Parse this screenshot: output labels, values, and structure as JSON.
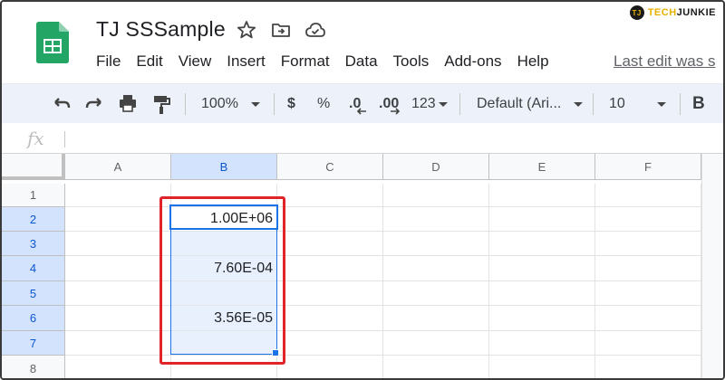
{
  "app": {
    "doc_title": "TJ SSSample",
    "menu": [
      "File",
      "Edit",
      "View",
      "Insert",
      "Format",
      "Data",
      "Tools",
      "Add-ons",
      "Help"
    ],
    "last_edit": "Last edit was s"
  },
  "watermark": {
    "badge": "TJ",
    "tech": "TECH",
    "junkie": "JUNKIE"
  },
  "toolbar": {
    "zoom": "100%",
    "currency": "$",
    "percent": "%",
    "decrease_decimal": ".0",
    "increase_decimal": ".00",
    "more_formats": "123",
    "font": "Default (Ari...",
    "font_size": "10",
    "bold": "B"
  },
  "formula_bar": {
    "fx_label": "fx",
    "value": ""
  },
  "sheet": {
    "columns": [
      "A",
      "B",
      "C",
      "D",
      "E",
      "F"
    ],
    "rows": [
      "1",
      "2",
      "3",
      "4",
      "5",
      "6",
      "7",
      "8"
    ],
    "cells": {
      "B2": "1.00E+06",
      "B4": "7.60E-04",
      "B6": "3.56E-05"
    },
    "active_cell": "B2",
    "selected_range": "B2:B7"
  },
  "colors": {
    "accent": "#1a73e8",
    "selection_fill": "#e8f0fe",
    "highlight_box": "#e0242a",
    "sheets_green": "#23a566"
  }
}
